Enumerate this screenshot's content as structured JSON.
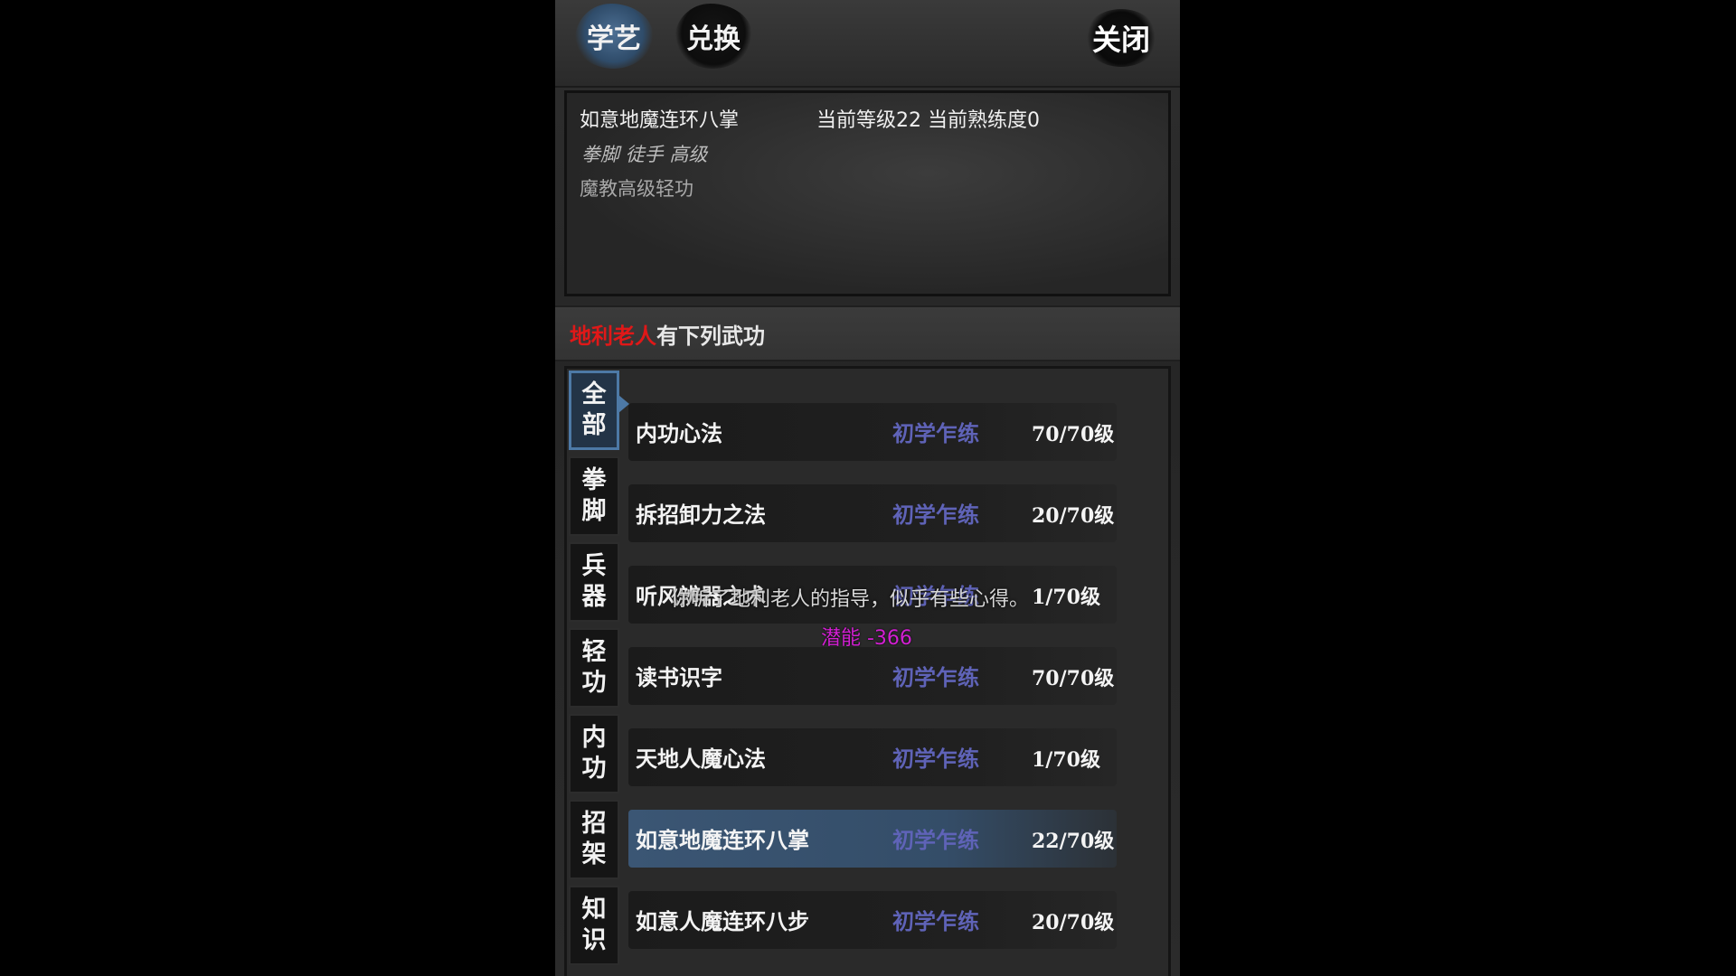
{
  "tabs": [
    {
      "label": "学艺",
      "active": true
    },
    {
      "label": "兑换",
      "active": false
    }
  ],
  "close_label": "关闭",
  "info": {
    "skill_name": "如意地魔连环八掌",
    "level_line": "当前等级22  当前熟练度0",
    "categories": "拳脚 徒手 高级",
    "description": "魔教高级轻功"
  },
  "teacher": {
    "name": "地利老人",
    "suffix": "有下列武功",
    "name_color": "#e01818"
  },
  "categories": [
    {
      "label1": "全",
      "label2": "部",
      "active": true
    },
    {
      "label1": "拳",
      "label2": "脚",
      "active": false
    },
    {
      "label1": "兵",
      "label2": "器",
      "active": false
    },
    {
      "label1": "轻",
      "label2": "功",
      "active": false
    },
    {
      "label1": "内",
      "label2": "功",
      "active": false
    },
    {
      "label1": "招",
      "label2": "架",
      "active": false
    },
    {
      "label1": "知",
      "label2": "识",
      "active": false
    }
  ],
  "skills": [
    {
      "name": "内功心法",
      "stage": "初学乍练",
      "level": "70/70级",
      "selected": false
    },
    {
      "name": "拆招卸力之法",
      "stage": "初学乍练",
      "level": "20/70级",
      "selected": false
    },
    {
      "name": "听风辨器之术",
      "stage": "初学乍练",
      "level": "1/70级",
      "selected": false
    },
    {
      "name": "读书识字",
      "stage": "初学乍练",
      "level": "70/70级",
      "selected": false
    },
    {
      "name": "天地人魔心法",
      "stage": "初学乍练",
      "level": "1/70级",
      "selected": false
    },
    {
      "name": "如意地魔连环八掌",
      "stage": "初学乍练",
      "level": "22/70级",
      "selected": true
    },
    {
      "name": "如意人魔连环八步",
      "stage": "初学乍练",
      "level": "20/70级",
      "selected": false
    }
  ],
  "notice": "你听了地利老人的指导，似乎有些心得。",
  "potential": "潜能 -366",
  "colors": {
    "accent": "#4d79a6",
    "stage_text": "#5f63b8",
    "potential": "#d21fd2"
  }
}
